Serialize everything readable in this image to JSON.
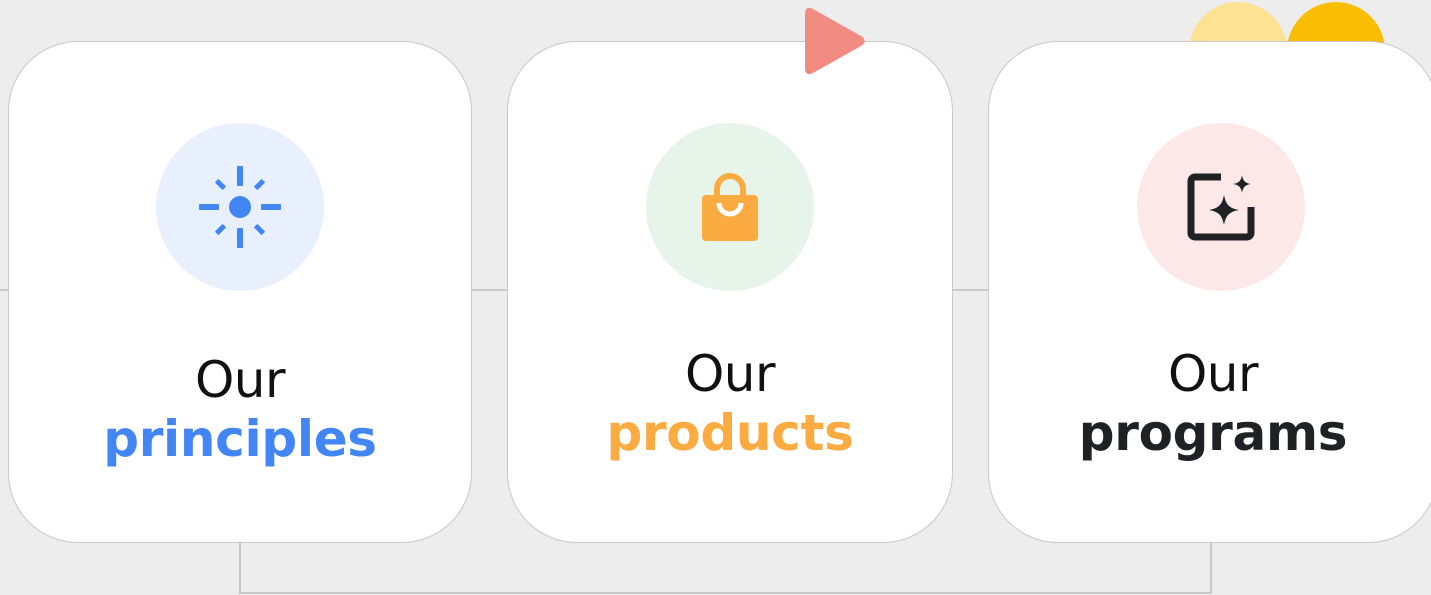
{
  "cards": [
    {
      "line1": "Our",
      "line2": "principles",
      "accent": "#4285f4",
      "circle_bg": "#e8f0fe",
      "icon": "sun-spark-icon"
    },
    {
      "line1": "Our",
      "line2": "products",
      "accent": "#fbab40",
      "circle_bg": "#e6f4ea",
      "icon": "shopping-bag-icon"
    },
    {
      "line1": "Our",
      "line2": "programs",
      "accent": "#202124",
      "circle_bg": "#fce8e6",
      "icon": "sparkle-frame-icon"
    }
  ],
  "decorations": {
    "play_triangle_color": "#f28b82",
    "dot_light_color": "#fde293",
    "dot_dark_color": "#fbbc04"
  }
}
